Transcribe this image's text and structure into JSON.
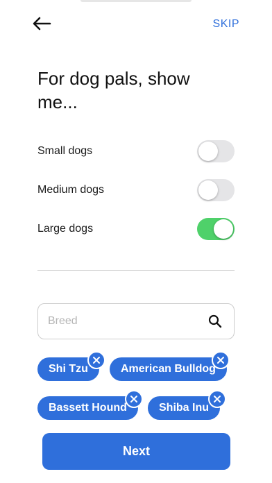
{
  "header": {
    "back_icon": "arrow-left-icon",
    "skip_label": "SKIP"
  },
  "title": "For dog pals, show me...",
  "preferences": [
    {
      "label": "Small dogs",
      "enabled": false
    },
    {
      "label": "Medium dogs",
      "enabled": false
    },
    {
      "label": "Large dogs",
      "enabled": true
    }
  ],
  "search": {
    "placeholder": "Breed",
    "value": "",
    "icon": "search-icon"
  },
  "selected_breeds": [
    {
      "label": "Shi Tzu"
    },
    {
      "label": "American Bulldog"
    },
    {
      "label": "Bassett Hound"
    },
    {
      "label": "Shiba Inu"
    }
  ],
  "next_label": "Next",
  "colors": {
    "accent": "#2f6fdb",
    "toggle_on": "#4fd16a",
    "toggle_off": "#e5e5e7"
  }
}
